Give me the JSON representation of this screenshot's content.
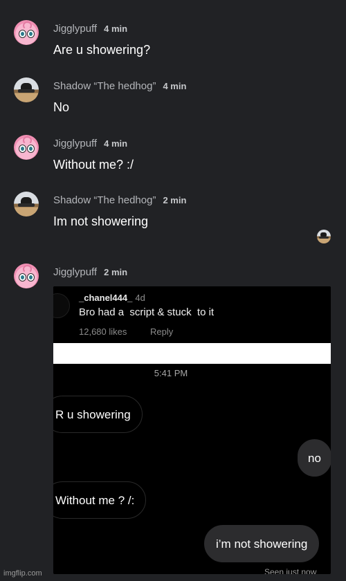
{
  "messages": [
    {
      "author": "Jigglypuff",
      "time": "4 min",
      "text": "Are u showering?",
      "avatar": "jigglypuff-avatar"
    },
    {
      "author": "Shadow “The hedhog”",
      "time": "4 min",
      "text": "No",
      "avatar": "shadow-avatar"
    },
    {
      "author": "Jigglypuff",
      "time": "4 min",
      "text": "Without me? :/",
      "avatar": "jigglypuff-avatar"
    },
    {
      "author": "Shadow “The hedhog”",
      "time": "2 min",
      "text": "Im not showering",
      "avatar": "shadow-avatar"
    },
    {
      "author": "Jigglypuff",
      "time": "2 min",
      "text": "",
      "avatar": "jigglypuff-avatar"
    }
  ],
  "screenshot": {
    "comment": {
      "username": "_chanel444_",
      "age": "4d",
      "text": "Bro had a  script & stuck  to it",
      "likes": "12,680 likes",
      "reply_label": "Reply"
    },
    "chat_time": "5:41 PM",
    "bubbles": [
      {
        "text": "R u showering",
        "side": "received"
      },
      {
        "text": "no",
        "side": "sent"
      },
      {
        "text": "Without me ? /:",
        "side": "received"
      },
      {
        "text": "i’m not showering",
        "side": "sent"
      }
    ],
    "seen_text": "Seen just now"
  },
  "watermark": "imgflip.com",
  "colors": {
    "background": "#212225",
    "name": "#b4b6ba",
    "pink": "#f7b6cf"
  }
}
